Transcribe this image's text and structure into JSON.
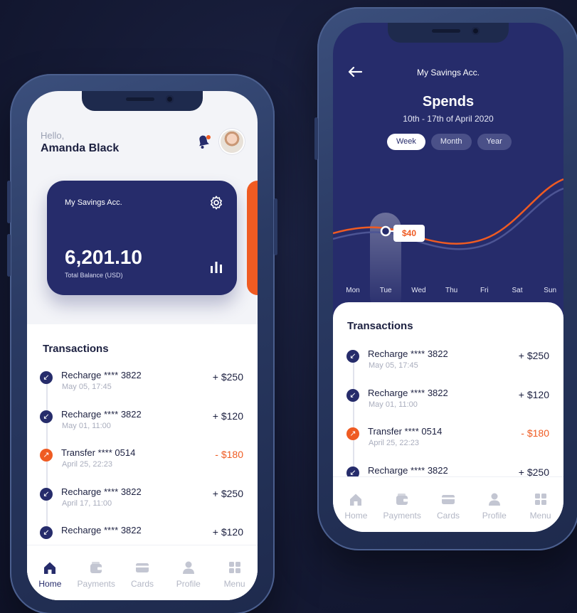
{
  "home": {
    "greeting": "Hello,",
    "user_name": "Amanda Black",
    "card": {
      "title": "My Savings Acc.",
      "balance": "6,201.10",
      "balance_label": "Total Balance (USD)"
    },
    "transactions_heading": "Transactions",
    "transactions": [
      {
        "title": "Recharge **** 3822",
        "date": "May 05, 17:45",
        "amount": "+ $250",
        "type": "in"
      },
      {
        "title": "Recharge **** 3822",
        "date": "May 01, 11:00",
        "amount": "+ $120",
        "type": "in"
      },
      {
        "title": "Transfer **** 0514",
        "date": "April 25, 22:23",
        "amount": "- $180",
        "type": "out"
      },
      {
        "title": "Recharge **** 3822",
        "date": "April 17, 11:00",
        "amount": "+ $250",
        "type": "in"
      },
      {
        "title": "Recharge **** 3822",
        "date": "",
        "amount": "+ $120",
        "type": "in"
      }
    ],
    "nav": [
      {
        "label": "Home",
        "icon": "home-icon"
      },
      {
        "label": "Payments",
        "icon": "wallet-icon"
      },
      {
        "label": "Cards",
        "icon": "card-icon"
      },
      {
        "label": "Profile",
        "icon": "user-icon"
      },
      {
        "label": "Menu",
        "icon": "grid-icon"
      }
    ],
    "active_nav": "Home"
  },
  "spends": {
    "account_title": "My Savings Acc.",
    "title": "Spends",
    "date_range": "10th - 17th of April 2020",
    "tabs": [
      "Week",
      "Month",
      "Year"
    ],
    "active_tab": "Week",
    "days": [
      "Mon",
      "Tue",
      "Wed",
      "Thu",
      "Fri",
      "Sat",
      "Sun"
    ],
    "selected_day": "Tue",
    "tooltip_value": "$40",
    "transactions_heading": "Transactions",
    "transactions": [
      {
        "title": "Recharge **** 3822",
        "date": "May 05, 17:45",
        "amount": "+ $250",
        "type": "in"
      },
      {
        "title": "Recharge **** 3822",
        "date": "May 01, 11:00",
        "amount": "+ $120",
        "type": "in"
      },
      {
        "title": "Transfer **** 0514",
        "date": "April 25, 22:23",
        "amount": "- $180",
        "type": "out"
      },
      {
        "title": "Recharge **** 3822",
        "date": "",
        "amount": "+ $250",
        "type": "in"
      }
    ],
    "nav": [
      {
        "label": "Home",
        "icon": "home-icon"
      },
      {
        "label": "Payments",
        "icon": "wallet-icon"
      },
      {
        "label": "Cards",
        "icon": "card-icon"
      },
      {
        "label": "Profile",
        "icon": "user-icon"
      },
      {
        "label": "Menu",
        "icon": "grid-icon"
      }
    ],
    "active_nav": ""
  },
  "colors": {
    "primary": "#262c6b",
    "accent": "#ef5b22",
    "background": "#151a35"
  }
}
